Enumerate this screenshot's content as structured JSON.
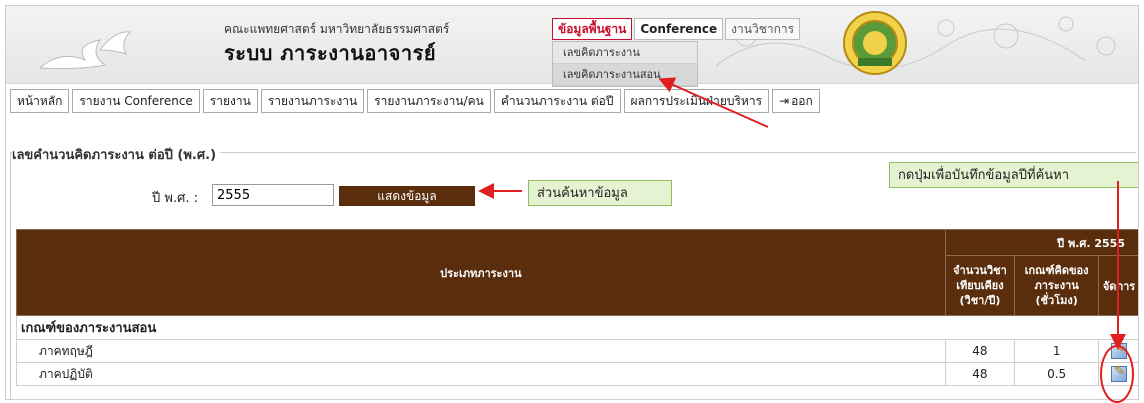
{
  "header": {
    "faculty": "คณะแพทยศาสตร์ มหาวิทยาลัยธรรมศาสตร์",
    "system_title": "ระบบ ภาระงานอาจารย์",
    "top_nav": [
      "ข้อมูลพื้นฐาน",
      "Conference",
      "งานวิชาการ"
    ],
    "dropdown": [
      "เลขคิดภาระงาน",
      "เลขคิดภาระงานสอน"
    ]
  },
  "menu": [
    "หน้าหลัก",
    "รายงาน Conference",
    "รายงาน",
    "รายงานภาระงาน",
    "รายงานภาระงาน/คน",
    "คำนวนภาระงาน ต่อปี",
    "ผลการประเมินฝ่ายบริหาร",
    "ออก"
  ],
  "section": {
    "legend": "เลขคำนวนคิดภาระงาน ต่อปี (พ.ศ.)"
  },
  "search": {
    "year_label": "ปี พ.ศ. :",
    "year_value": "2555",
    "show_button": "แสดงข้อมูล"
  },
  "annotations": {
    "search_callout": "ส่วนค้นหาข้อมูล",
    "save_callout": "กดปุ่มเพื่อบันทึกข้อมูลปีที่ค้นหา"
  },
  "table": {
    "col_type": "ประเภทภาระงาน",
    "year_header": "ปี พ.ศ. 2555",
    "col_count": "จำนวนวิชาเทียบเคียง (วิชา/ปี)",
    "col_criteria": "เกณฑ์คิดของภาระงาน (ชั่วโมง)",
    "col_manage": "จัดการ",
    "group": "เกณฑ์ของภาระงานสอน",
    "rows": [
      {
        "name": "ภาคทฤษฎี",
        "count": "48",
        "criteria": "1"
      },
      {
        "name": "ภาคปฏิบัติ",
        "count": "48",
        "criteria": "0.5"
      }
    ]
  },
  "colors": {
    "brown": "#5a2d0c",
    "active_red": "#c8102e",
    "callout_green": "#e6f3d2",
    "arrow_red": "#e02020"
  },
  "icons": [
    "bird-logo-icon",
    "university-seal-icon",
    "logout-icon",
    "edit-icon"
  ]
}
